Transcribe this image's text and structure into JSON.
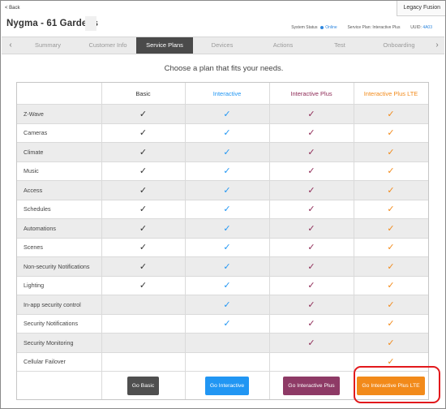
{
  "header": {
    "back_label": "< Back",
    "legacy_label": "Legacy Fusion",
    "title": "Nygma - 61 Gardens",
    "system_status_label": "System Status",
    "system_status_value": "Online",
    "service_plan_label": "Service Plan:",
    "service_plan_value": "Interactive Plus",
    "uuid_label": "UUID:",
    "uuid_value": "4A03"
  },
  "tabs": [
    {
      "label": "Summary"
    },
    {
      "label": "Customer Info"
    },
    {
      "label": "Service Plans"
    },
    {
      "label": "Devices"
    },
    {
      "label": "Actions"
    },
    {
      "label": "Test"
    },
    {
      "label": "Onboarding"
    }
  ],
  "tab_arrows": {
    "left": "‹",
    "right": "›"
  },
  "headline": "Choose a plan that fits your needs.",
  "plans": [
    {
      "name": "Basic",
      "color": "#333333",
      "button": "Go Basic",
      "button_color": "#4f4f4f"
    },
    {
      "name": "Interactive",
      "color": "#2196f3",
      "button": "Go Interactive",
      "button_color": "#2196f3"
    },
    {
      "name": "Interactive Plus",
      "color": "#8e2a56",
      "button": "Go Interactive Plus",
      "button_color": "#8e3a66"
    },
    {
      "name": "Interactive Plus LTE",
      "color": "#f28a1a",
      "button": "Go Interactive Plus LTE",
      "button_color": "#f28a1a"
    }
  ],
  "check_glyph": "✓",
  "features": [
    {
      "name": "Z-Wave",
      "included": [
        true,
        true,
        true,
        true
      ]
    },
    {
      "name": "Cameras",
      "included": [
        true,
        true,
        true,
        true
      ]
    },
    {
      "name": "Climate",
      "included": [
        true,
        true,
        true,
        true
      ]
    },
    {
      "name": "Music",
      "included": [
        true,
        true,
        true,
        true
      ]
    },
    {
      "name": "Access",
      "included": [
        true,
        true,
        true,
        true
      ]
    },
    {
      "name": "Schedules",
      "included": [
        true,
        true,
        true,
        true
      ]
    },
    {
      "name": "Automations",
      "included": [
        true,
        true,
        true,
        true
      ]
    },
    {
      "name": "Scenes",
      "included": [
        true,
        true,
        true,
        true
      ]
    },
    {
      "name": "Non-security Notifications",
      "included": [
        true,
        true,
        true,
        true
      ]
    },
    {
      "name": "Lighting",
      "included": [
        true,
        true,
        true,
        true
      ]
    },
    {
      "name": "In-app security control",
      "included": [
        false,
        true,
        true,
        true
      ]
    },
    {
      "name": "Security Notifications",
      "included": [
        false,
        true,
        true,
        true
      ]
    },
    {
      "name": "Security Monitoring",
      "included": [
        false,
        false,
        true,
        true
      ]
    },
    {
      "name": "Cellular Failover",
      "included": [
        false,
        false,
        false,
        true
      ]
    }
  ]
}
